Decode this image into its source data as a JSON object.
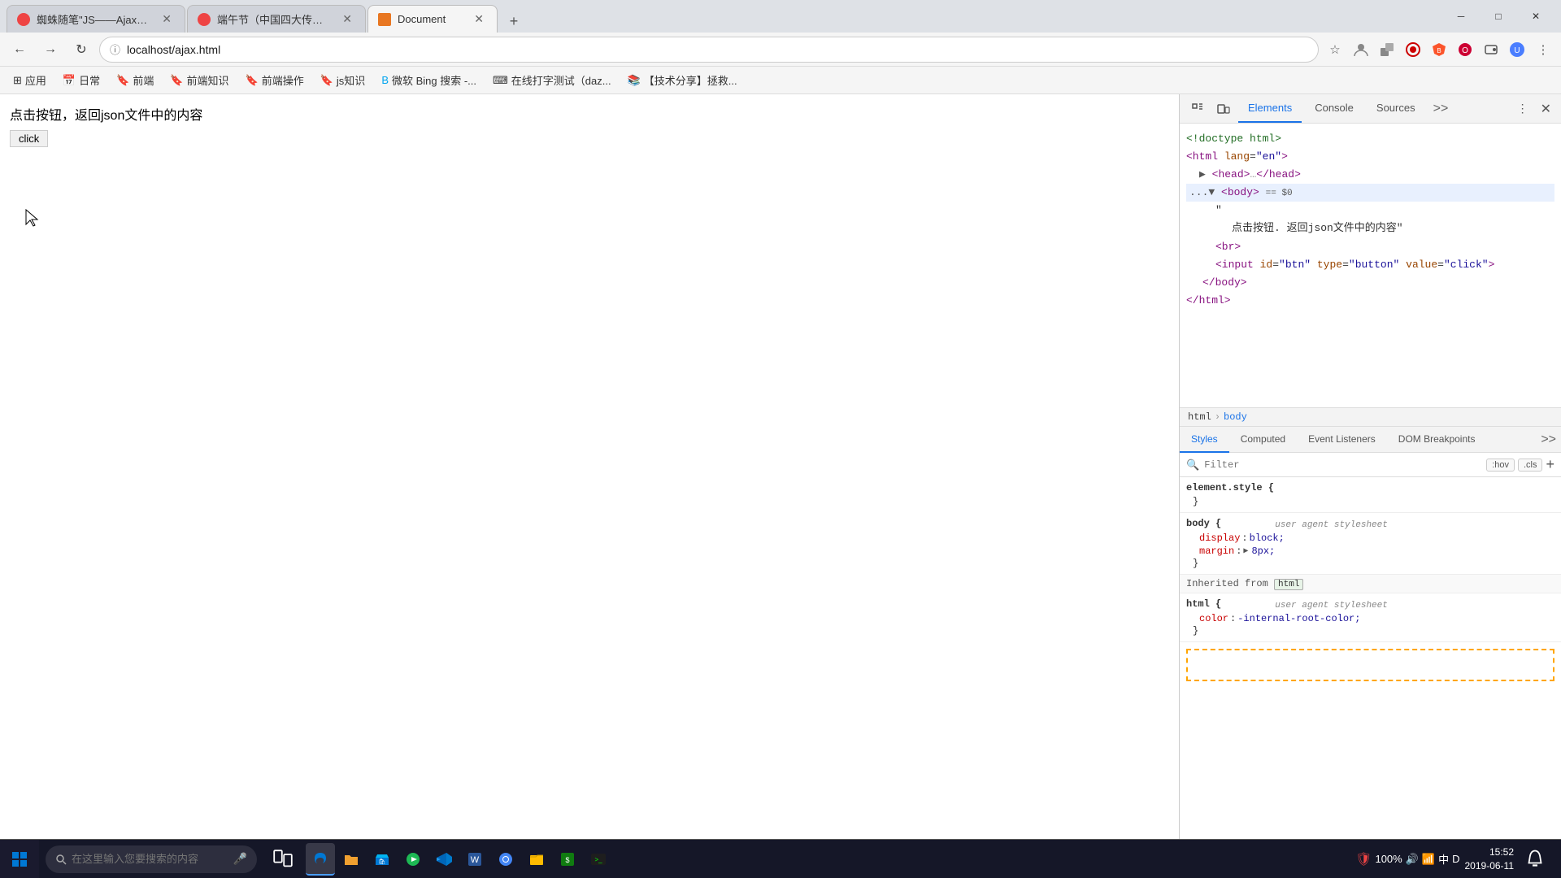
{
  "browser": {
    "tabs": [
      {
        "id": "tab1",
        "label": "蜘蛛随笔\"JS——Ajax原理应用",
        "favicon_color": "#e44",
        "active": false
      },
      {
        "id": "tab2",
        "label": "端午节（中国四大传统节日之一",
        "favicon_color": "#e44",
        "active": false
      },
      {
        "id": "tab3",
        "label": "Document",
        "favicon_color": "#e87722",
        "active": true
      }
    ],
    "new_tab_label": "+",
    "nav": {
      "back_disabled": false,
      "forward_disabled": false,
      "reload": "↻",
      "address": "localhost/ajax.html"
    },
    "bookmarks": [
      {
        "label": "应用"
      },
      {
        "label": "日常"
      },
      {
        "label": "前端"
      },
      {
        "label": "前端知识"
      },
      {
        "label": "前端操作"
      },
      {
        "label": "js知识"
      },
      {
        "label": "微软 Bing 搜索 -..."
      },
      {
        "label": "在线打字测试（daz..."
      },
      {
        "label": "【技术分享】拯救..."
      }
    ]
  },
  "page": {
    "text": "点击按钮，返回json文件中的内容",
    "button_label": "click"
  },
  "devtools": {
    "tabs": [
      "Elements",
      "Console",
      "Sources",
      ">>"
    ],
    "active_tab": "Elements",
    "dom": {
      "lines": [
        {
          "indent": 0,
          "content": "<!doctype html>",
          "type": "comment"
        },
        {
          "indent": 0,
          "content": "<html lang=\"en\">",
          "type": "tag"
        },
        {
          "indent": 1,
          "content": "▶ <head>…</head>",
          "type": "collapsed"
        },
        {
          "indent": 1,
          "content": "<body> == $0",
          "type": "tag-selected",
          "selected": true
        },
        {
          "indent": 2,
          "content": "\"",
          "type": "text"
        },
        {
          "indent": 3,
          "content": "点击按钮. 返回json文件中的内容\"",
          "type": "text"
        },
        {
          "indent": 2,
          "content": "<br>",
          "type": "tag"
        },
        {
          "indent": 2,
          "content": "<input id=\"btn\" type=\"button\" value=\"click\">",
          "type": "tag"
        },
        {
          "indent": 1,
          "content": "</body>",
          "type": "tag"
        },
        {
          "indent": 0,
          "content": "</html>",
          "type": "tag"
        }
      ]
    },
    "breadcrumb": [
      "html",
      "body"
    ],
    "styles_tabs": [
      "Styles",
      "Computed",
      "Event Listeners",
      "DOM Breakpoints",
      ">>"
    ],
    "active_styles_tab": "Styles",
    "filter_placeholder": "Filter",
    "filter_actions": [
      ":hov",
      ".cls",
      "+"
    ],
    "style_rules": [
      {
        "selector": "element.style {",
        "source": "",
        "props": [],
        "close": "}"
      },
      {
        "selector": "body {",
        "source": "user agent stylesheet",
        "props": [
          {
            "name": "display",
            "value": "block;"
          },
          {
            "name": "margin",
            "value": "▶ 8px;",
            "has_arrow": true
          }
        ],
        "close": "}"
      },
      {
        "type": "inherited",
        "label": "Inherited from",
        "tag": "html"
      },
      {
        "selector": "html {",
        "source": "user agent stylesheet",
        "props": [
          {
            "name": "color",
            "value": "-internal-root-color;"
          }
        ],
        "close": "}"
      }
    ]
  },
  "taskbar": {
    "search_placeholder": "在这里输入您要搜索的内容",
    "time": "15:52",
    "date": "2019-06-11",
    "apps": [
      {
        "label": "Windows",
        "type": "start"
      },
      {
        "label": "Search"
      },
      {
        "label": "Task View"
      },
      {
        "label": "Edge"
      },
      {
        "label": "File Explorer"
      },
      {
        "label": "App Store"
      },
      {
        "label": "Media"
      },
      {
        "label": "VS Code"
      },
      {
        "label": "Office"
      },
      {
        "label": "Chrome"
      },
      {
        "label": "Files"
      },
      {
        "label": "Finance"
      },
      {
        "label": "Dev"
      }
    ]
  }
}
